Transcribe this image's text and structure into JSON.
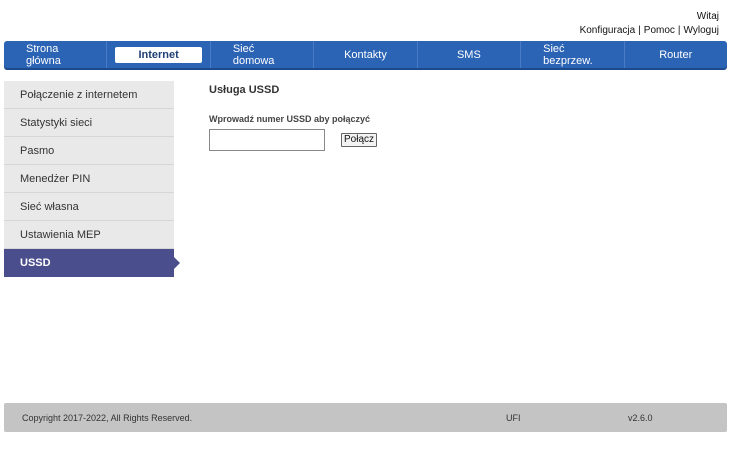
{
  "header": {
    "greeting": "Witaj",
    "links": [
      "Konfiguracja",
      "Pomoc",
      "Wyloguj"
    ],
    "separator": "|"
  },
  "nav": {
    "items": [
      {
        "label": "Strona główna"
      },
      {
        "label": "Internet"
      },
      {
        "label": "Sieć domowa"
      },
      {
        "label": "Kontakty"
      },
      {
        "label": "SMS"
      },
      {
        "label": "Sieć bezprzew."
      },
      {
        "label": "Router"
      }
    ],
    "active": "Internet"
  },
  "sidebar": {
    "items": [
      {
        "label": "Połączenie z internetem"
      },
      {
        "label": "Statystyki sieci"
      },
      {
        "label": "Pasmo"
      },
      {
        "label": "Menedżer PIN"
      },
      {
        "label": "Sieć własna"
      },
      {
        "label": "Ustawienia MEP"
      },
      {
        "label": "USSD"
      }
    ],
    "active": "USSD"
  },
  "main": {
    "title": "Usługa USSD",
    "field_label": "Wprowadź numer USSD aby połączyć",
    "input_value": "",
    "input_placeholder": "",
    "connect_label": "Połącz"
  },
  "footer": {
    "copyright": "Copyright 2017-2022, All Rights Reserved.",
    "model": "UFI",
    "version": "v2.6.0"
  },
  "colors": {
    "nav_bg": "#2b63b5",
    "sidebar_bg": "#e9e9e9",
    "sidebar_active_bg": "#4a4e8c",
    "footer_bg": "#c4c4c4"
  }
}
